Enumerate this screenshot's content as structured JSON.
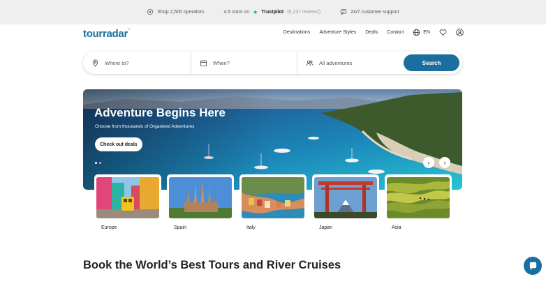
{
  "topbar": {
    "operators": "Shop 2,500 operators",
    "rating_prefix": "4.5 stars on",
    "trustpilot": "Trustpilot",
    "reviews": "(6,237 reviews)",
    "support": "24/7 customer support"
  },
  "header": {
    "logo": "tourradar",
    "nav": [
      "Destinations",
      "Adventure Styles",
      "Deals",
      "Contact"
    ],
    "language": "EN"
  },
  "search": {
    "where_placeholder": "Where to?",
    "when_placeholder": "When?",
    "adventures_label": "All adventures",
    "button": "Search"
  },
  "hero": {
    "title": "Adventure Begins Here",
    "subtitle": "Choose from thousands of Organized Adventures",
    "cta": "Check out deals",
    "slide_count": 2,
    "active_slide": 1
  },
  "destinations": [
    {
      "label": "Europe",
      "image": "colorful-street-with-yellow-tram"
    },
    {
      "label": "Spain",
      "image": "sagrada-familia"
    },
    {
      "label": "Italy",
      "image": "cinque-terre-coastal-village"
    },
    {
      "label": "Japan",
      "image": "torii-gate-and-mount-fuji"
    },
    {
      "label": "Asia",
      "image": "rice-terraces"
    }
  ],
  "section": {
    "title": "Book the World’s Best Tours and River Cruises"
  },
  "colors": {
    "brand": "#1b6f9e",
    "trustpilot": "#00b67a",
    "topbar_bg": "#efefef"
  },
  "icons": [
    "operators-icon",
    "trustpilot-star-icon",
    "chat-support-icon",
    "globe-icon",
    "heart-icon",
    "user-icon",
    "location-pin-icon",
    "calendar-icon",
    "people-icon",
    "chevron-left-icon",
    "chevron-right-icon",
    "chat-bubble-icon"
  ]
}
